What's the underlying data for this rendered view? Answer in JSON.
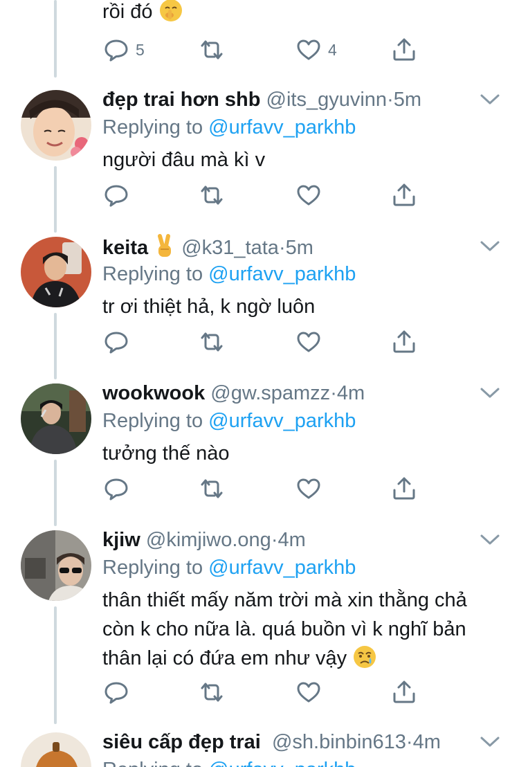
{
  "colors": {
    "text": "#14171a",
    "muted": "#657786",
    "link": "#1da1f2",
    "thread_line": "#cfd9de"
  },
  "top_tweet": {
    "text": "rồi đó",
    "emoji": "shushing-face-emoji",
    "reply_count": "5",
    "like_count": "4"
  },
  "replying_prefix": "Replying to",
  "replies": [
    {
      "name": "đẹp trai hơn shb",
      "handle": "@its_gyuvinn",
      "dot": "·",
      "time": "5m",
      "replying_to": "@urfavv_parkhb",
      "text": "người đâu mà kì v"
    },
    {
      "name": "keita",
      "name_emoji": "victory-hand-emoji",
      "handle": "@k31_tata",
      "dot": "·",
      "time": "5m",
      "replying_to": "@urfavv_parkhb",
      "text": "tr ơi thiệt hả, k ngờ luôn"
    },
    {
      "name": "wookwook",
      "handle": "@gw.spamzz",
      "dot": "·",
      "time": "4m",
      "replying_to": "@urfavv_parkhb",
      "text": "tưởng thế nào"
    },
    {
      "name": "kjiw",
      "handle": "@kimjiwo.ong",
      "dot": "·",
      "time": "4m",
      "replying_to": "@urfavv_parkhb",
      "text": "thân thiết mấy năm trời mà xin thằng chả còn k cho nữa là. quá buồn vì k nghĩ bản thân lại có đứa em như vậy",
      "text_emoji": "crying-face-emoji"
    },
    {
      "name": "siêu cấp đẹp trai",
      "handle": "@sh.binbin613",
      "dot": "·",
      "time": "4m",
      "replying_to": "@urfavv_parkhb"
    }
  ],
  "icons": {
    "reply": "reply-icon",
    "retweet": "retweet-icon",
    "like": "heart-icon",
    "share": "share-icon",
    "menu": "chevron-down-icon"
  }
}
